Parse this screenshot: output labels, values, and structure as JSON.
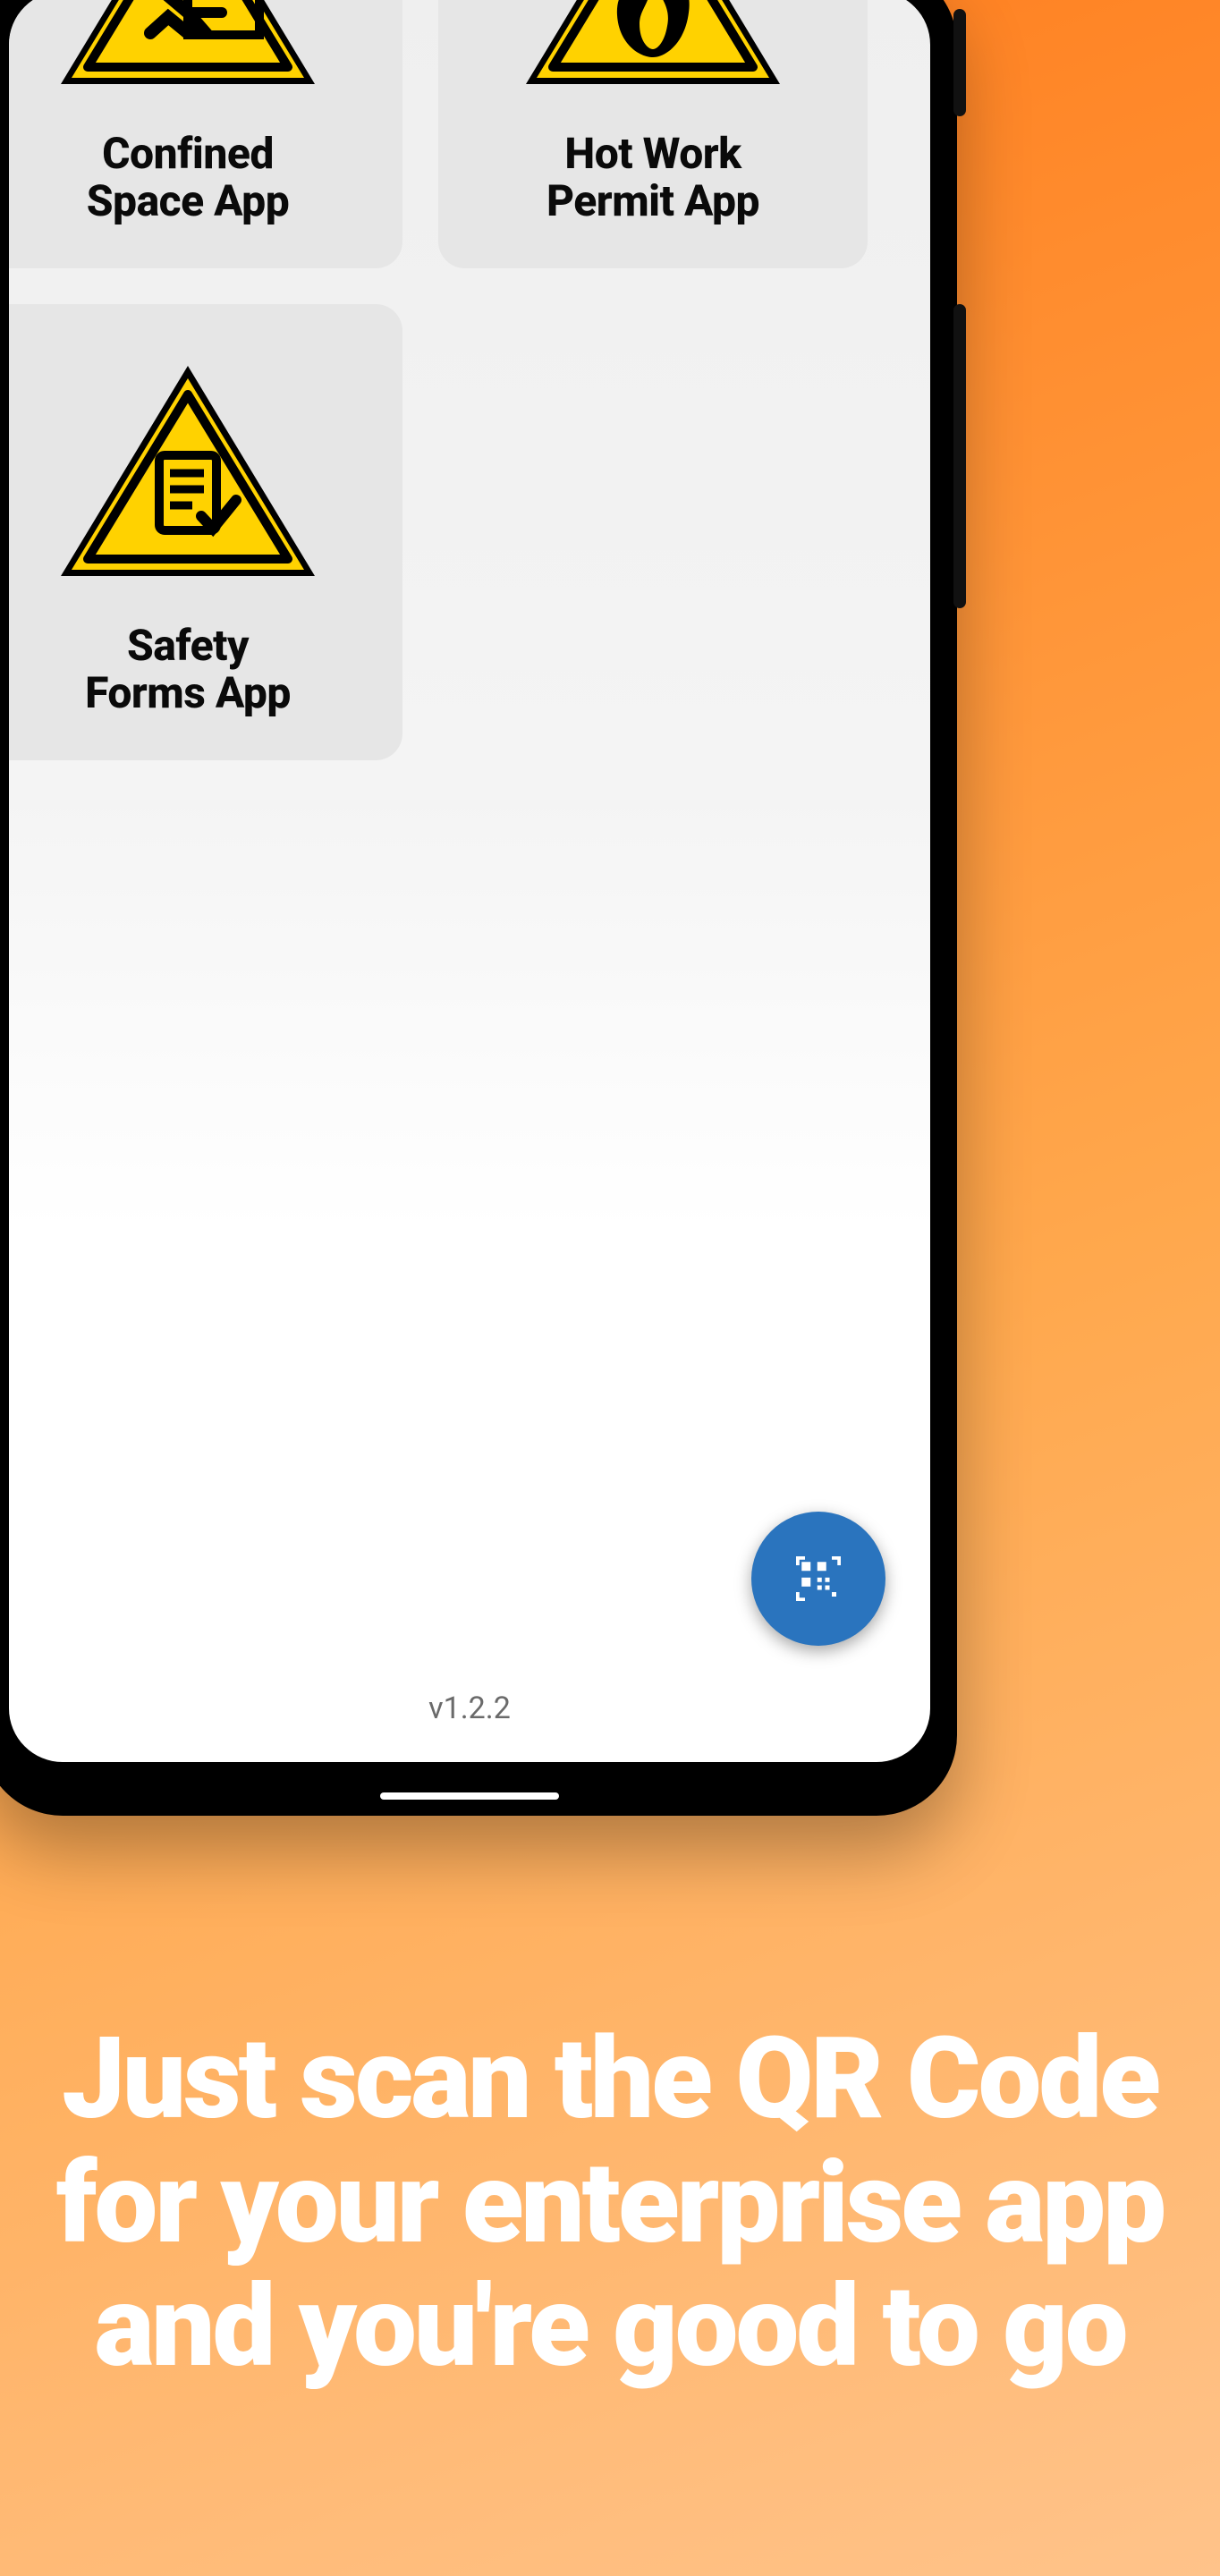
{
  "phone_app": {
    "tiles": [
      {
        "line1": "Confined",
        "line2": "Space App",
        "icon": "confined-space"
      },
      {
        "line1": "Hot Work",
        "line2": "Permit App",
        "icon": "flame"
      },
      {
        "line1": "Safety",
        "line2": "Forms App",
        "icon": "form-check"
      }
    ],
    "version": "v1.2.2",
    "fab_icon": "qr-code"
  },
  "headline": "Just scan the QR Code for your enterprise app and you're good to go"
}
